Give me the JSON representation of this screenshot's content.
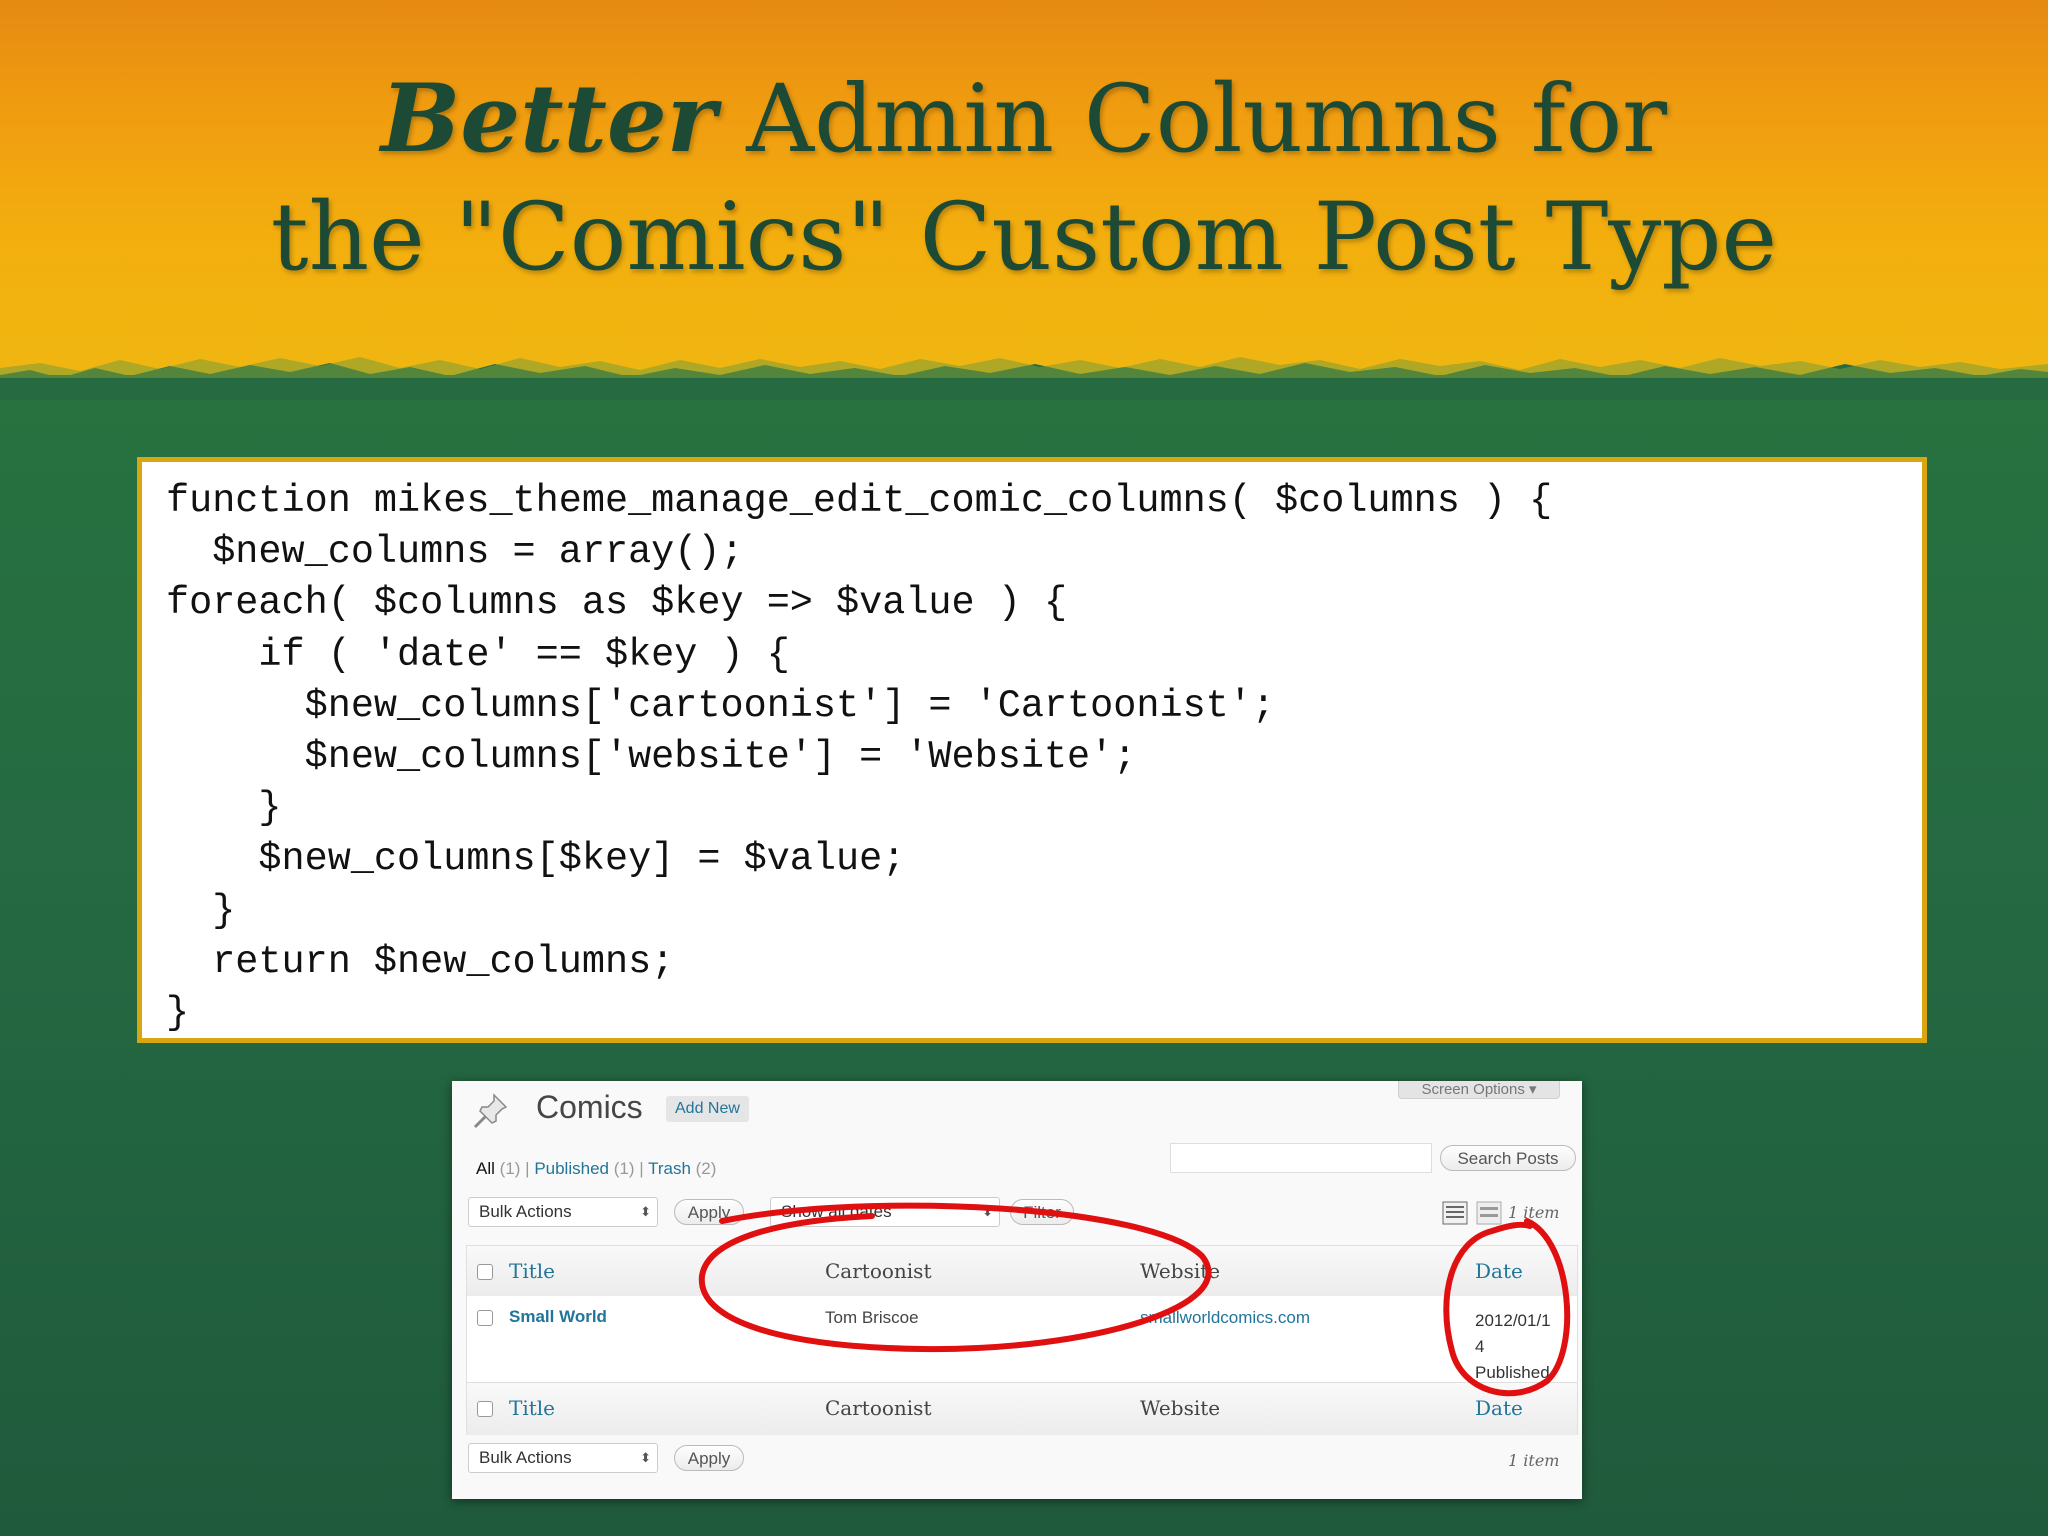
{
  "slide": {
    "title_em": "Better",
    "title_line1_rest": " Admin Columns for",
    "title_line2": "the \"Comics\" Custom Post Type",
    "code": "function mikes_theme_manage_edit_comic_columns( $columns ) {\n  $new_columns = array();\nforeach( $columns as $key => $value ) {\n    if ( 'date' == $key ) {\n      $new_columns['cartoonist'] = 'Cartoonist';\n      $new_columns['website'] = 'Website';\n    }\n    $new_columns[$key] = $value;\n  }\n  return $new_columns;\n}"
  },
  "screenshot": {
    "heading": "Comics",
    "add_new": "Add New",
    "screen_options": "Screen Options",
    "filters": {
      "all": "All",
      "all_count": "(1)",
      "published": "Published",
      "published_count": "(1)",
      "trash": "Trash",
      "trash_count": "(2)",
      "sep": "|"
    },
    "search_button": "Search Posts",
    "bulk_actions": "Bulk Actions",
    "apply": "Apply",
    "dates": "Show all dates",
    "filter": "Filter",
    "item_count": "1 item",
    "columns": {
      "title": "Title",
      "cartoonist": "Cartoonist",
      "website": "Website",
      "date": "Date"
    },
    "row": {
      "title": "Small World",
      "cartoonist": "Tom Briscoe",
      "website": "smallworldcomics.com",
      "date_line1": "2012/01/1",
      "date_line2": "4",
      "status": "Published"
    }
  },
  "colors": {
    "header_orange": "#f0a010",
    "background_green": "#256a41",
    "title_text": "#1d4a35",
    "code_border": "#d9a511",
    "wp_link": "#21759b",
    "annotation_red": "#e01010"
  }
}
